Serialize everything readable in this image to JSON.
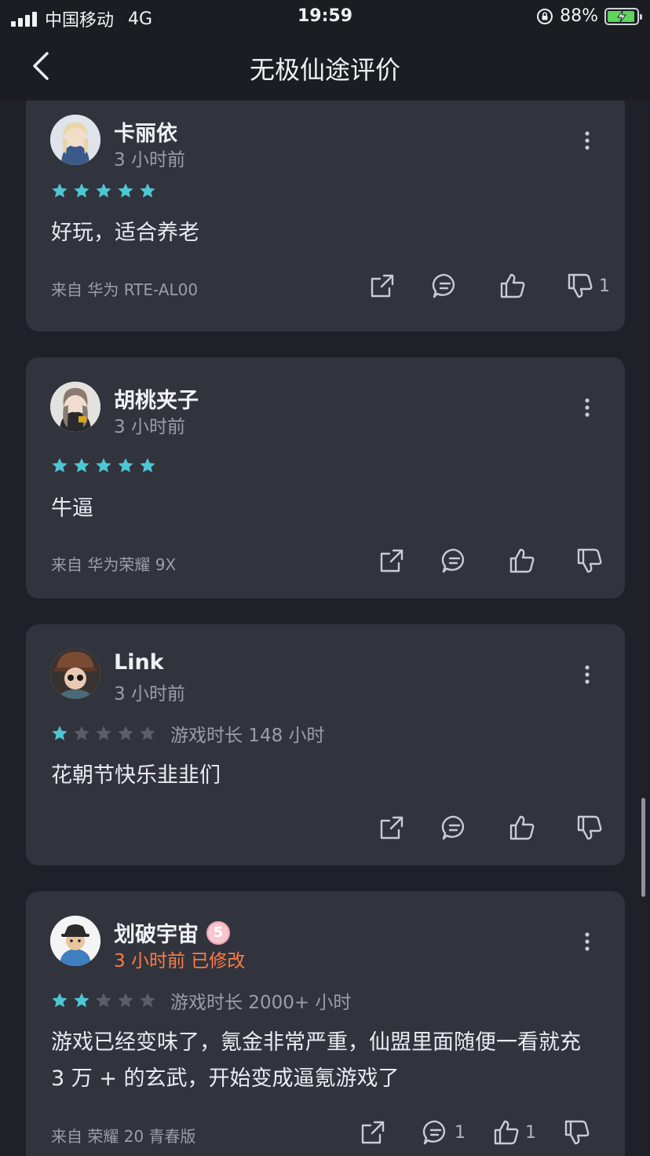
{
  "status_bar": {
    "carrier": "中国移动",
    "network": "4G",
    "time": "19:59",
    "battery": "88%",
    "colors": {
      "battery_fill": "#5fd35a"
    }
  },
  "nav": {
    "title": "无极仙途评价"
  },
  "colors": {
    "star_active": "#4fc6d4",
    "star_inactive": "#5a5e67",
    "edited_time": "#ff7a45"
  },
  "reviews": [
    {
      "username": "卡丽依",
      "time": "3 小时前",
      "rating": 5,
      "playtime": "",
      "text": "好玩，适合养老",
      "device": "来自 华为 RTE-AL00",
      "counts": {
        "comment": "",
        "like": "",
        "dislike": "1"
      }
    },
    {
      "username": "胡桃夹子",
      "time": "3 小时前",
      "rating": 5,
      "playtime": "",
      "text": "牛逼",
      "device": "来自 华为荣耀 9X",
      "counts": {
        "comment": "",
        "like": "",
        "dislike": ""
      }
    },
    {
      "username": "Link",
      "time": "3 小时前",
      "rating": 1,
      "playtime": "游戏时长 148 小时",
      "text": "花朝节快乐韭韭们",
      "device": "",
      "counts": {
        "comment": "",
        "like": "",
        "dislike": ""
      }
    },
    {
      "username": "划破宇宙",
      "badge": "5",
      "time": "3 小时前 已修改",
      "rating": 2,
      "playtime": "游戏时长 2000+ 小时",
      "text": "游戏已经变味了，氪金非常严重，仙盟里面随便一看就充 3 万 + 的玄武，开始变成逼氪游戏了",
      "device": "来自 荣耀 20 青春版",
      "counts": {
        "comment": "1",
        "like": "1",
        "dislike": ""
      }
    }
  ]
}
